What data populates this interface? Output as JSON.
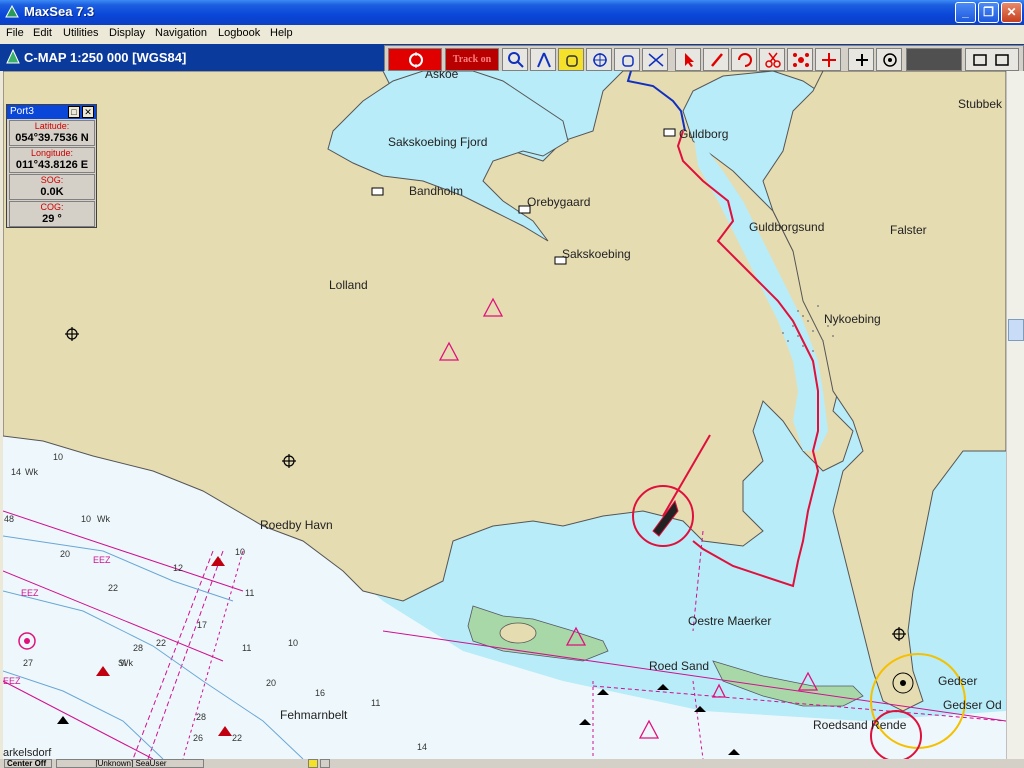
{
  "window": {
    "title": "MaxSea 7.3"
  },
  "menu": {
    "items": [
      "File",
      "Edit",
      "Utilities",
      "Display",
      "Navigation",
      "Logbook",
      "Help"
    ]
  },
  "chart": {
    "title": "C-MAP  1:250 000 [WGS84]"
  },
  "toolbar": {
    "track_label": "Track on"
  },
  "port_panel": {
    "title": "Port3",
    "latitude_label": "Latitude:",
    "latitude": "054°39.7536 N",
    "longitude_label": "Longitude:",
    "longitude": "011°43.8126 E",
    "sog_label": "SOG:",
    "sog": "0.0K",
    "cog_label": "COG:",
    "cog": "29 °"
  },
  "map_labels": {
    "askoe": "Askoe",
    "stubbek": "Stubbek",
    "guldborg": "Guldborg",
    "sakskoebing_fjord": "Sakskoebing Fjord",
    "bandholm": "Bandholm",
    "orebygaard": "Orebygaard",
    "guldborgsund": "Guldborgsund",
    "falster": "Falster",
    "sakskoebing": "Sakskoebing",
    "lolland": "Lolland",
    "nykoebing": "Nykoebing",
    "roedby_havn": "Roedby Havn",
    "oestre_maerker": "Oestre Maerker",
    "roed_sand": "Roed Sand",
    "gedser": "Gedser",
    "gedser_odde": "Gedser Od",
    "roedsand_rende": "Roedsand Rende",
    "fehmarnbelt": "Fehmarnbelt",
    "markelsdorf": "arkelsdorf",
    "eez1": "EEZ",
    "eez2": "EEZ",
    "eez3": "EEZ"
  },
  "depths": {
    "d1": "10",
    "d2": "14",
    "d3": "48",
    "d4": "10",
    "d5": "20",
    "d6": "12",
    "d7": "22",
    "d8": "17",
    "d9": "10",
    "d10": "11",
    "d11": "28",
    "d12": "11",
    "d13": "10",
    "d14": "27",
    "d15": "20",
    "d16": "16",
    "d17": "11",
    "d18": "28",
    "d19": "26",
    "d20": "22",
    "d21": "14",
    "d22": "22",
    "wk1": "Wk",
    "wk2": "Wk",
    "wk3": "Wk",
    "si": "Si"
  },
  "status": {
    "center": "Center Off",
    "user": "[Unknown] SeaUser"
  },
  "colors": {
    "land": "#e6dcb2",
    "water": "#b8ecf8",
    "deep_water": "#eef8fc",
    "track": "#e0103c",
    "route": "#1030c0"
  }
}
